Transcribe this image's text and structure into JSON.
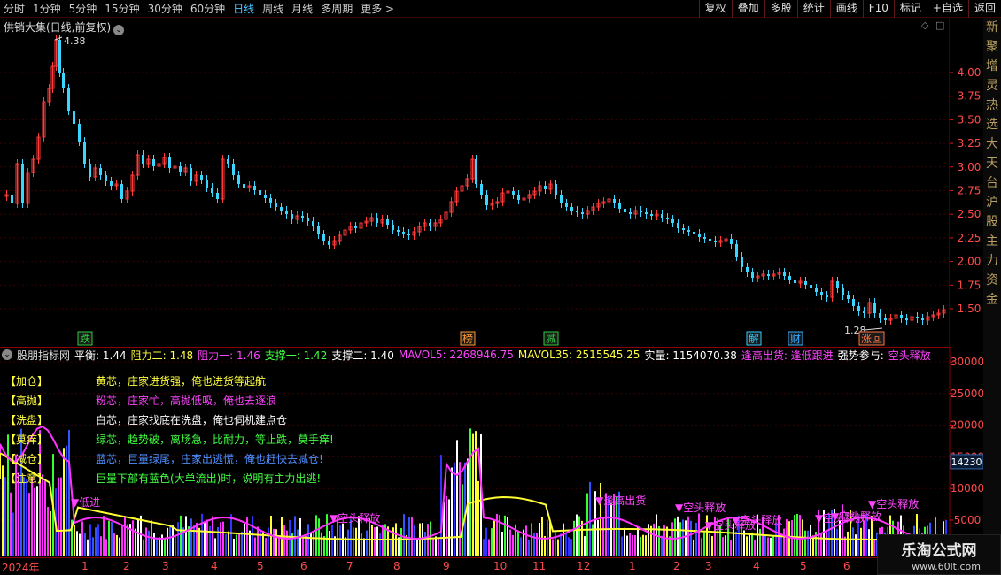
{
  "toolbar": {
    "period_tabs": [
      "分时",
      "1分钟",
      "5分钟",
      "15分钟",
      "30分钟",
      "60分钟",
      "日线",
      "周线",
      "月线",
      "多周期",
      "更多 >"
    ],
    "active_tab": "日线",
    "buttons": [
      "复权",
      "叠加",
      "多股",
      "统计",
      "画线",
      "F10",
      "标记",
      "+自选",
      "返回"
    ]
  },
  "price_panel": {
    "title": "供销大集(日线,前复权)",
    "high_label": "4.38",
    "low_label": "1.28",
    "markers": [
      {
        "text": "跌",
        "color": "#2ecc40"
      },
      {
        "text": "榜",
        "color": "#ff9933"
      },
      {
        "text": "减",
        "color": "#2ecc40"
      },
      {
        "text": "解",
        "color": "#33ccff"
      },
      {
        "text": "财",
        "color": "#33aaff"
      },
      {
        "text": "涨回",
        "color": "#ff7744"
      }
    ],
    "axis_labels": [
      "4.00",
      "3.75",
      "3.50",
      "3.25",
      "3.00",
      "2.75",
      "2.50",
      "2.25",
      "2.00",
      "1.75",
      "1.50"
    ]
  },
  "indicator": {
    "name": "股朋指标网",
    "values": [
      {
        "text": "平衡: 1.44",
        "color": "#ffffff"
      },
      {
        "text": "阻力二: 1.48",
        "color": "#ffff40"
      },
      {
        "text": "阻力一: 1.46",
        "color": "#ff44ff"
      },
      {
        "text": "支撑一: 1.42",
        "color": "#44ff44"
      },
      {
        "text": "支撑二: 1.40",
        "color": "#ffffff"
      },
      {
        "text": "MAVOL5: 2268946.75",
        "color": "#ff44ff"
      },
      {
        "text": "MAVOL35: 2515545.25",
        "color": "#ffff40"
      },
      {
        "text": "实量: 1154070.38",
        "color": "#ffffff"
      },
      {
        "text": "逢高出货: 逢低跟进",
        "color": "#ff44ff"
      },
      {
        "text": "强势参与:",
        "color": "#ffffff"
      },
      {
        "text": "空头释放",
        "color": "#ff44ff"
      }
    ],
    "legend": [
      {
        "tag": "【加仓】",
        "desc": "黄芯，庄家进货强，俺也进货等起航",
        "color": "#ffff40"
      },
      {
        "tag": "【高抛】",
        "desc": "粉芯，庄家忙，高抛低吸，俺也去逐浪",
        "color": "#ff44ff"
      },
      {
        "tag": "【洗盘】",
        "desc": "白芯，庄家找底在洗盘，俺也伺机建点仓",
        "color": "#ffffff"
      },
      {
        "tag": "【莫痒】",
        "desc": "绿芯，趋势破，离场急，比耐力，等止跌，莫手痒!",
        "color": "#44ff44"
      },
      {
        "tag": "【减仓】",
        "desc": "蓝芯，巨量绿尾，庄家出逃慌，俺也赶快去减仓!",
        "color": "#4f8fff"
      },
      {
        "tag": "【注意】",
        "desc": "巨量下部有蓝色(大单流出)时，说明有主力出逃!",
        "color": "#44ff44"
      }
    ],
    "axis_labels": [
      "30000",
      "25000",
      "20000",
      "15000",
      "10000",
      "5000"
    ],
    "current_value": "14230",
    "signals": [
      "▼低进",
      "▼逢高出货",
      "▼空头释放",
      "▼空头释放",
      "▼空头释放",
      "▼空头释放",
      "▼空头释放",
      "▼空头释放",
      "▼空头释放"
    ]
  },
  "time_axis": [
    "2024年",
    "1",
    "2",
    "3",
    "4",
    "5",
    "6",
    "7",
    "8",
    "9",
    "10",
    "11",
    "12",
    "1",
    "2",
    "3",
    "4",
    "5",
    "6"
  ],
  "right_strip": [
    "新",
    "聚",
    "增",
    "灵",
    "热",
    "选",
    "大",
    "天",
    "台",
    "沪",
    "股",
    "主",
    "力",
    "资",
    "金"
  ],
  "watermark": {
    "title": "乐淘公式网",
    "url": "www.60lt.com"
  }
}
